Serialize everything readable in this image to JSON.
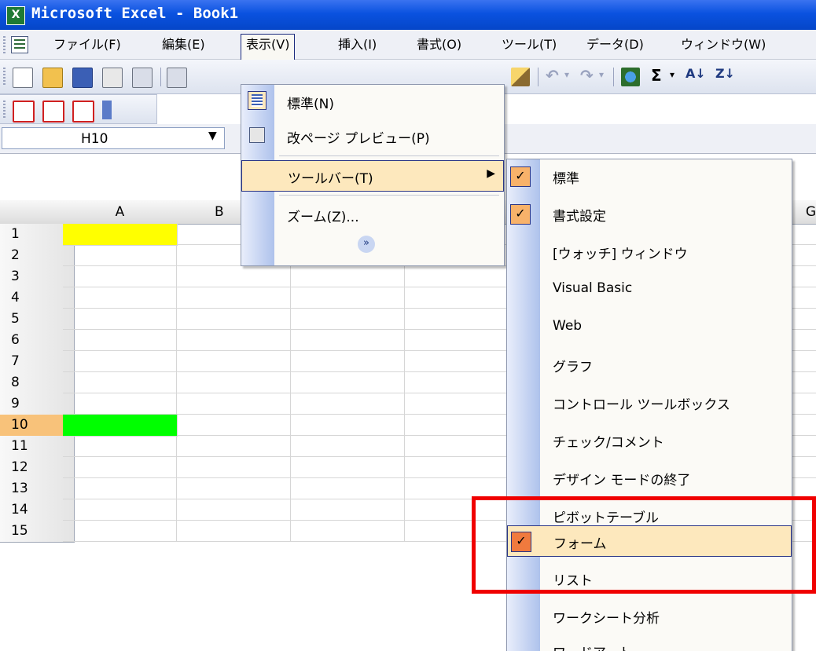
{
  "window": {
    "title": "Microsoft Excel - Book1"
  },
  "menubar": {
    "items": [
      "ファイル(F)",
      "編集(E)",
      "表示(V)",
      "挿入(I)",
      "書式(O)",
      "ツール(T)",
      "データ(D)",
      "ウィンドウ(W)"
    ]
  },
  "namebox": {
    "value": "H10"
  },
  "columns": [
    "A",
    "B",
    "G"
  ],
  "rows": [
    "1",
    "2",
    "3",
    "4",
    "5",
    "6",
    "7",
    "8",
    "9",
    "10",
    "11",
    "12",
    "13",
    "14",
    "15"
  ],
  "colors": {
    "cell_a1": "#ffff00",
    "cell_a10": "#00ff00",
    "highlight": "#fde8bd",
    "annotation": "#f00000"
  },
  "view_menu": {
    "items": [
      "標準(N)",
      "改ページ プレビュー(P)",
      "ツールバー(T)",
      "ズーム(Z)..."
    ],
    "expand_icon": "chevron-double-down-icon"
  },
  "toolbar_submenu": {
    "items": [
      {
        "label": "標準",
        "checked": true
      },
      {
        "label": "書式設定",
        "checked": true
      },
      {
        "label": "[ウォッチ] ウィンドウ",
        "checked": false
      },
      {
        "label": "Visual Basic",
        "checked": false
      },
      {
        "label": "Web",
        "checked": false
      },
      {
        "label": "グラフ",
        "checked": false
      },
      {
        "label": "コントロール ツールボックス",
        "checked": false
      },
      {
        "label": "チェック/コメント",
        "checked": false
      },
      {
        "label": "デザイン モードの終了",
        "checked": false
      },
      {
        "label": "ピボットテーブル",
        "checked": false
      },
      {
        "label": "フォーム",
        "checked": true
      },
      {
        "label": "リスト",
        "checked": false
      },
      {
        "label": "ワークシート分析",
        "checked": false
      },
      {
        "label": "ワードアート",
        "checked": false
      }
    ]
  }
}
